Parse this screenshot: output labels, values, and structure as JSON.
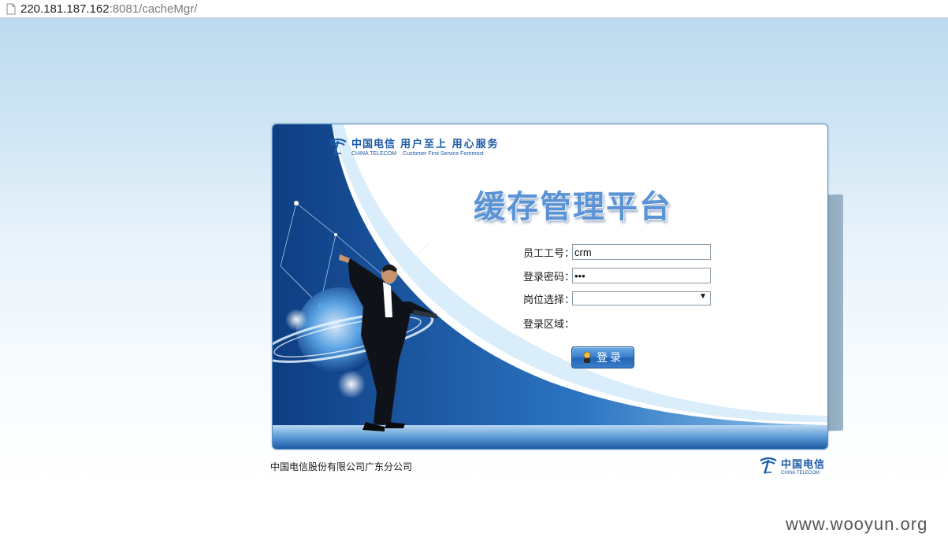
{
  "browser": {
    "address_host": "220.181.187.162",
    "address_rest": ":8081/cacheMgr/"
  },
  "brand": {
    "company_cn": "中国电信",
    "company_en": "CHINA TELECOM",
    "slogan_cn": "用户至上  用心服务",
    "slogan_en": "Customer First Service Foremost"
  },
  "login": {
    "title": "缓存管理平台",
    "employee_id_label": "员工工号：",
    "employee_id_value": "crm",
    "password_label": "登录密码：",
    "password_value": "•••",
    "position_label": "岗位选择：",
    "position_value": "",
    "region_label": "登录区域：",
    "submit_label": "登录"
  },
  "footer": {
    "company": "中国电信股份有限公司广东分公司",
    "logo_cn": "中国电信",
    "logo_en": "CHINA TELECOM"
  },
  "watermark": "www.wooyun.org",
  "colors": {
    "brand_blue": "#1b5aa8",
    "title_blue": "#5b94d6",
    "button_blue": "#2366b5"
  }
}
